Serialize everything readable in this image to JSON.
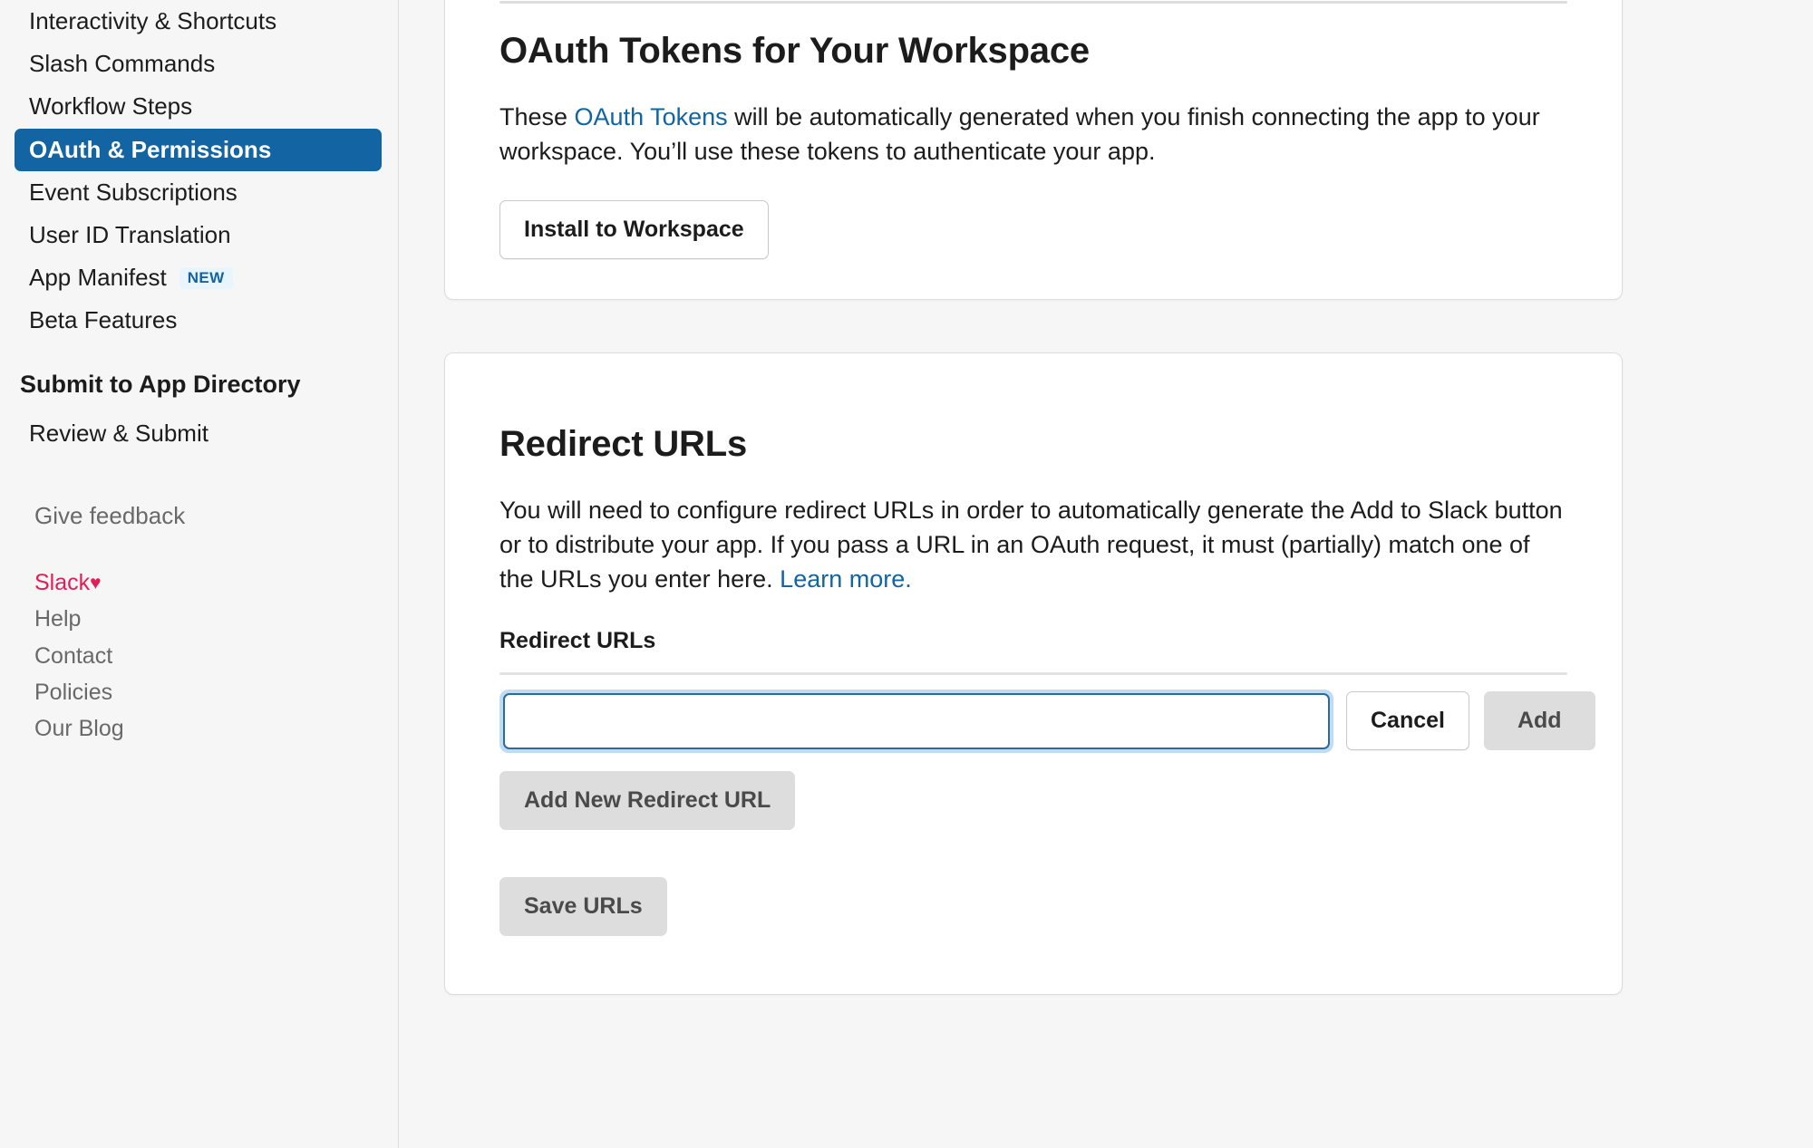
{
  "sidebar": {
    "nav_items": [
      {
        "label": "Interactivity & Shortcuts",
        "active": false
      },
      {
        "label": "Slash Commands",
        "active": false
      },
      {
        "label": "Workflow Steps",
        "active": false
      },
      {
        "label": "OAuth & Permissions",
        "active": true
      },
      {
        "label": "Event Subscriptions",
        "active": false
      },
      {
        "label": "User ID Translation",
        "active": false
      },
      {
        "label": "App Manifest",
        "active": false,
        "badge": "NEW"
      },
      {
        "label": "Beta Features",
        "active": false
      }
    ],
    "section_title": "Submit to App Directory",
    "sub_link": "Review & Submit",
    "feedback": "Give feedback",
    "footer_links": [
      {
        "label": "Slack",
        "brand": true,
        "heart": "♥"
      },
      {
        "label": "Help",
        "brand": false
      },
      {
        "label": "Contact",
        "brand": false
      },
      {
        "label": "Policies",
        "brand": false
      },
      {
        "label": "Our Blog",
        "brand": false
      }
    ]
  },
  "oauth_card": {
    "title": "OAuth Tokens for Your Workspace",
    "body_part1": "These ",
    "body_link": "OAuth Tokens",
    "body_part2": " will be automatically generated when you finish connecting the app to your workspace. You’ll use these tokens to authenticate your app.",
    "install_button": "Install to Workspace"
  },
  "redirect_card": {
    "title": "Redirect URLs",
    "body_part1": "You will need to configure redirect URLs in order to automatically generate the Add to Slack button or to distribute your app. If you pass a URL in an OAuth request, it must (partially) match one of the URLs you enter here. ",
    "body_link": "Learn more.",
    "field_label": "Redirect URLs",
    "input_value": "",
    "input_placeholder": "",
    "cancel_button": "Cancel",
    "add_button": "Add",
    "add_new_button": "Add New Redirect URL",
    "save_button": "Save URLs"
  },
  "colors": {
    "active_nav": "#1264a3",
    "link": "#1264a3",
    "brand_pink": "#e01e5a",
    "badge_bg": "#e8f5fd",
    "page_bg": "#f6f6f6",
    "focus_ring": "#bfdcf2"
  }
}
